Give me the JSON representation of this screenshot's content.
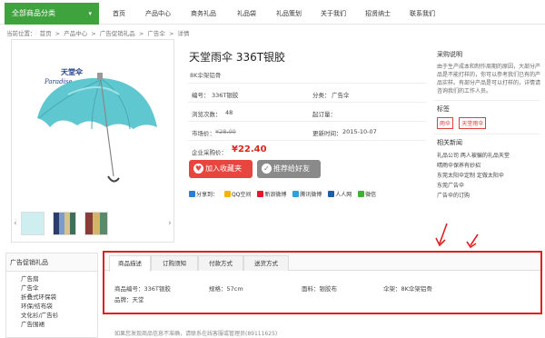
{
  "nav": {
    "all_label": "全部商品分类",
    "links": [
      "首页",
      "产品中心",
      "商务礼品",
      "礼品袋",
      "礼品策划",
      "关于我们",
      "招贤纳士",
      "联系我们"
    ]
  },
  "breadcrumb": [
    "当前位置：",
    "首页",
    ">",
    "产品中心",
    ">",
    "广告促销礼品",
    ">",
    "广告伞",
    ">",
    "详情"
  ],
  "gallery": {
    "brand_text": "天堂伞",
    "brand_sub": "Paradise"
  },
  "product": {
    "title": "天堂雨伞 336T银胶",
    "subtitle": "8K伞架铝骨",
    "rows": [
      {
        "l": "编号：",
        "lv": "336T银胶",
        "r": "分类：",
        "rv": "广告伞"
      },
      {
        "l": "浏览次数：",
        "lv": "48",
        "r": "起订量：",
        "rv": ""
      },
      {
        "l": "市场价：",
        "lv": "¥28.00",
        "r": "更新时间：",
        "rv": "2015-10-07"
      }
    ],
    "price_label": "企业采购价：",
    "price": "¥22.40",
    "buy_label": "加入收藏夹",
    "recommend_label": "推荐给好友"
  },
  "share": {
    "lead": "分享到：",
    "items": [
      "QQ空间",
      "新浪微博",
      "腾讯微博",
      "人人网",
      "微信"
    ]
  },
  "side": {
    "purchase_title": "采购说明",
    "purchase_text": "由于生产成本和制作周期的原因，大部分产品是不能打样的，你可以参考我们已有的产品实样。有部分产品是可以打样的，详情请咨询我们的工作人员。",
    "tag_title": "标签",
    "tags": [
      "雨伞",
      "天堂雨伞"
    ],
    "news_title": "相关新闻",
    "news": [
      "礼品公司 两人被骗的礼品天堂",
      "晴雨伞保养有妙招",
      "东莞太阳伞定制 定做太阳伞",
      "东莞广告伞",
      "广告伞的订购"
    ]
  },
  "left_menu": {
    "title": "广告促销礼品",
    "items": [
      "广告扇",
      "广告伞",
      "折叠式环保袋",
      "环保/纺布袋",
      "文化衫/广告衫",
      "广告围裙"
    ]
  },
  "tabs": [
    "商品描述",
    "订购须知",
    "付款方式",
    "送货方式"
  ],
  "specs": {
    "a": "商品编号：336T银胶",
    "b": "规格：57cm",
    "c": "面料：银胶布",
    "d": "伞架：8K伞架铝骨",
    "e": "品牌：天堂"
  },
  "notice": "如果您发现商品信息不准确，请联系在线客服或管理员(89111625)"
}
